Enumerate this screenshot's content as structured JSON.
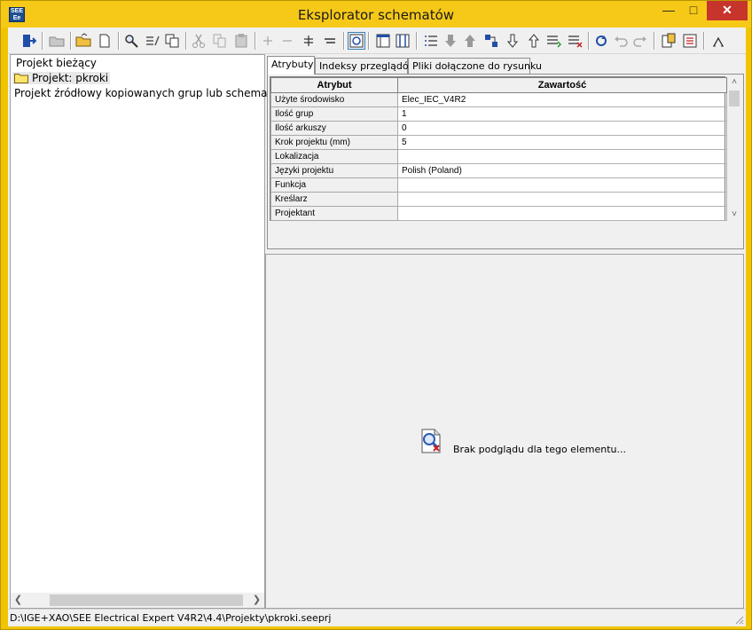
{
  "window": {
    "title": "Eksplorator schematów",
    "app_icon_text": "SEE\nEe",
    "controls": [
      "minimize",
      "maximize",
      "close"
    ]
  },
  "toolbar": {
    "buttons": [
      "exit-icon",
      "open-folder-icon",
      "open-project-icon",
      "new-document-icon",
      "find-icon",
      "edit-attributes-icon",
      "copy-project-icon",
      "cut-icon",
      "copy-icon",
      "paste-icon",
      "add-icon",
      "remove-icon",
      "insert-icon",
      "align-icon",
      "preview-icon",
      "view-columns-icon",
      "view-grid-icon",
      "list-icon",
      "move-down-icon",
      "move-up-icon",
      "group-icon",
      "hand-down-icon",
      "hand-up-icon",
      "renumber-icon",
      "report-icon",
      "refresh-icon",
      "undo-icon",
      "redo-icon",
      "properties-icon",
      "print-icon",
      "font-icon"
    ]
  },
  "tree": {
    "items": [
      {
        "label": "Projekt bieżący"
      },
      {
        "label": "Projekt: pkroki"
      },
      {
        "label": "Projekt źródłowy kopiowanych grup lub schematów"
      }
    ]
  },
  "tabs": [
    {
      "label": "Atrybuty"
    },
    {
      "label": "Indeksy przeglądów"
    },
    {
      "label": "Pliki dołączone do rysunku"
    }
  ],
  "attributes": {
    "headers": [
      "Atrybut",
      "Zawartość"
    ],
    "rows": [
      {
        "name": "Użyte środowisko",
        "value": "Elec_IEC_V4R2"
      },
      {
        "name": "Ilość grup",
        "value": "1"
      },
      {
        "name": "Ilość arkuszy",
        "value": "0"
      },
      {
        "name": "Krok projektu (mm)",
        "value": "5"
      },
      {
        "name": "Lokalizacja",
        "value": ""
      },
      {
        "name": "Języki projektu",
        "value": "Polish (Poland)"
      },
      {
        "name": "Funkcja",
        "value": ""
      },
      {
        "name": "Kreślarz",
        "value": ""
      },
      {
        "name": "Projektant",
        "value": ""
      }
    ]
  },
  "preview": {
    "message": "Brak podglądu dla tego elementu..."
  },
  "statusbar": {
    "path": "D:\\IGE+XAO\\SEE Electrical Expert V4R2\\4.4\\Projekty\\pkroki.seeprj"
  },
  "colors": {
    "frame": "#f6c918",
    "close": "#c7342b",
    "folder": "#ffe46b"
  }
}
